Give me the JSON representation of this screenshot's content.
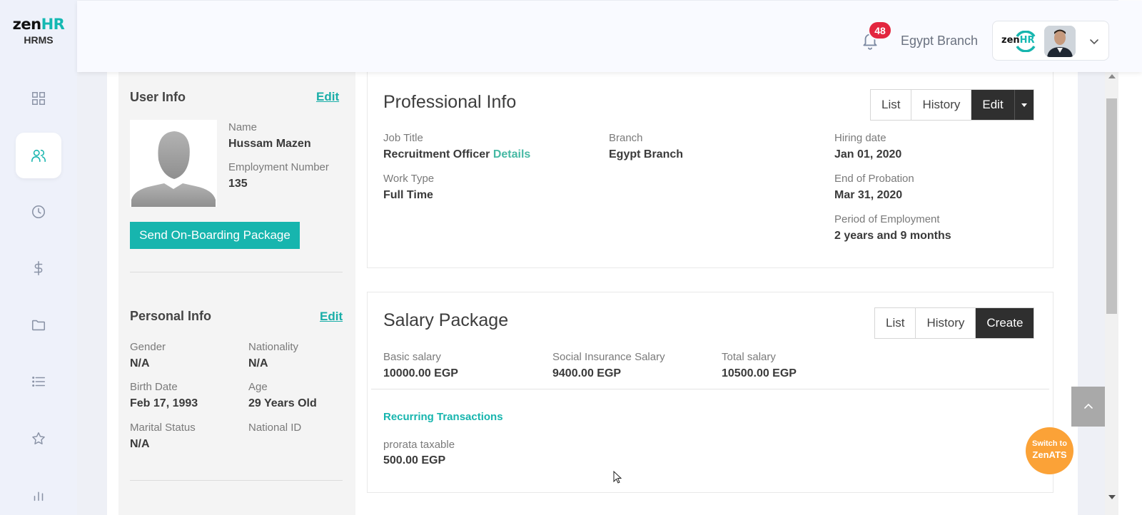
{
  "brand": {
    "logo_main": "zen",
    "logo_accent": "HR",
    "logo_sub": "HRMS"
  },
  "sidebar": {
    "items": [
      {
        "icon": "dashboard-grid-icon",
        "active": false
      },
      {
        "icon": "users-icon",
        "active": true
      },
      {
        "icon": "clock-icon",
        "active": false
      },
      {
        "icon": "dollar-icon",
        "active": false
      },
      {
        "icon": "folder-icon",
        "active": false
      },
      {
        "icon": "list-icon",
        "active": false
      },
      {
        "icon": "star-icon",
        "active": false
      },
      {
        "icon": "bar-chart-icon",
        "active": false
      }
    ]
  },
  "header": {
    "notification_count": "48",
    "branch": "Egypt Branch",
    "profile_logo_main": "zen",
    "profile_logo_accent": "HR"
  },
  "user_info": {
    "title": "User Info",
    "edit": "Edit",
    "name_label": "Name",
    "name": "Hussam Mazen",
    "emp_label": "Employment Number",
    "emp_number": "135",
    "onboarding_button": "Send On-Boarding Package"
  },
  "personal_info": {
    "title": "Personal Info",
    "edit": "Edit",
    "gender_label": "Gender",
    "gender": "N/A",
    "nationality_label": "Nationality",
    "nationality": "N/A",
    "birth_label": "Birth Date",
    "birth": "Feb 17, 1993",
    "age_label": "Age",
    "age": "29 Years Old",
    "marital_label": "Marital Status",
    "marital": "N/A",
    "national_id_label": "National ID"
  },
  "professional_info": {
    "title": "Professional Info",
    "buttons": {
      "list": "List",
      "history": "History",
      "edit": "Edit"
    },
    "job_title_label": "Job Title",
    "job_title": "Recruitment Officer",
    "details_link": "Details",
    "branch_label": "Branch",
    "branch": "Egypt Branch",
    "hiring_label": "Hiring date",
    "hiring": "Jan 01, 2020",
    "work_type_label": "Work Type",
    "work_type": "Full Time",
    "probation_label": "End of Probation",
    "probation": "Mar 31, 2020",
    "period_label": "Period of Employment",
    "period": "2 years and 9 months"
  },
  "salary_package": {
    "title": "Salary Package",
    "buttons": {
      "list": "List",
      "history": "History",
      "create": "Create"
    },
    "basic_label": "Basic salary",
    "basic": "10000.00 EGP",
    "social_label": "Social Insurance Salary",
    "social": "9400.00 EGP",
    "total_label": "Total salary",
    "total": "10500.00 EGP",
    "recurring_title": "Recurring Transactions",
    "recurring_item_label": "prorata taxable",
    "recurring_item_value": "500.00 EGP"
  },
  "switch_bubble": {
    "line1": "Switch to",
    "line2": "ZenATS"
  },
  "colors": {
    "accent": "#17b5ae",
    "dark_button": "#2f2f2f",
    "badge": "#e3263f",
    "bubble": "#fba237"
  }
}
